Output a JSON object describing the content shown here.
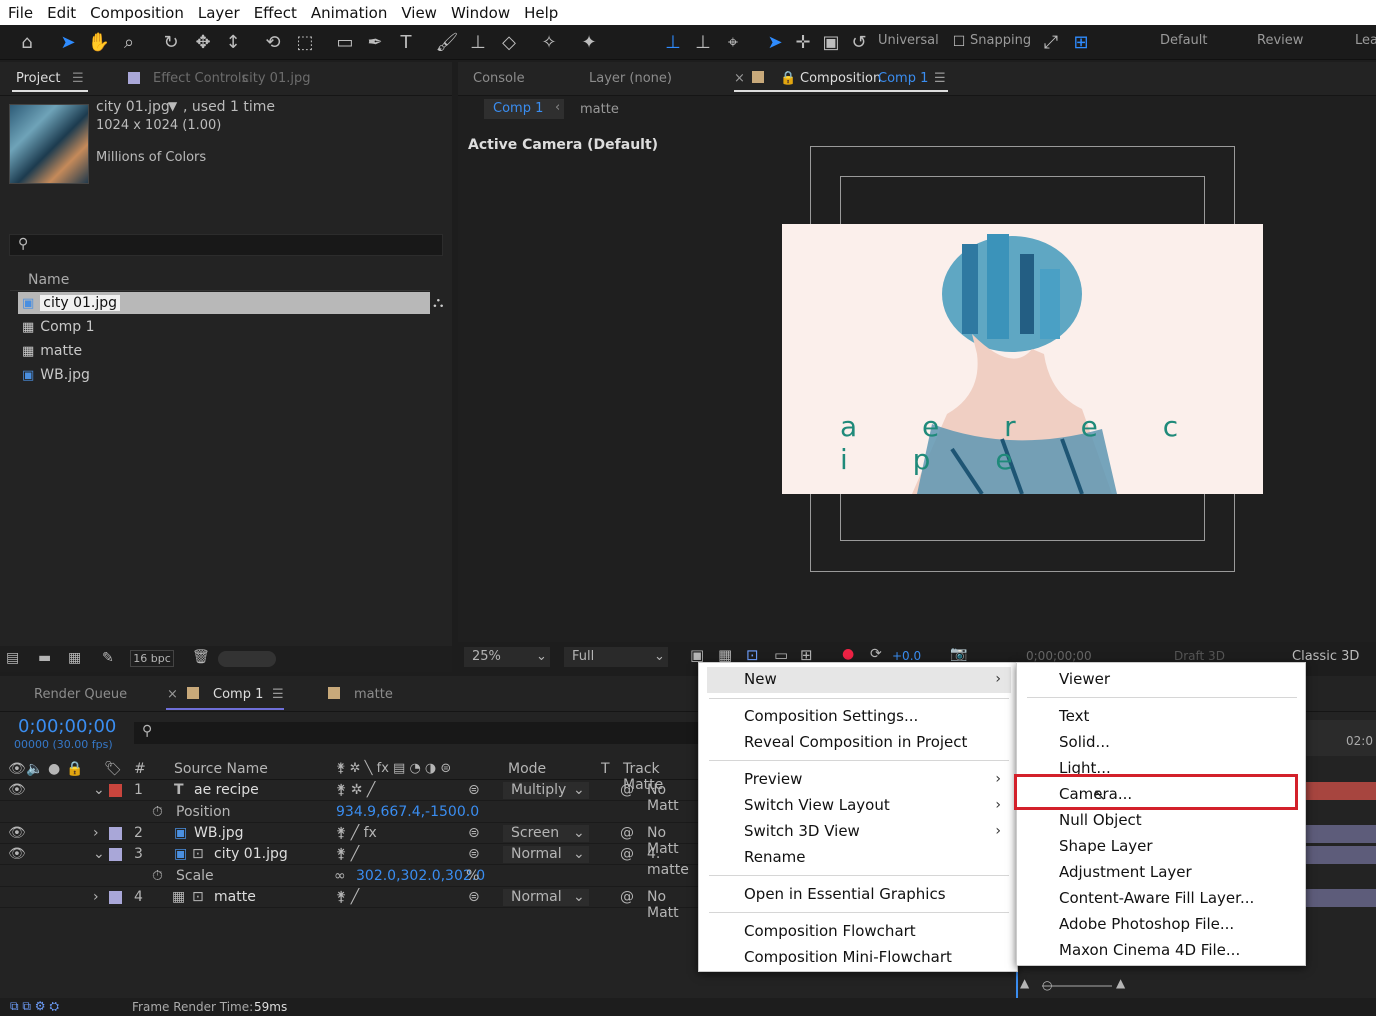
{
  "menubar": [
    "File",
    "Edit",
    "Composition",
    "Layer",
    "Effect",
    "Animation",
    "View",
    "Window",
    "Help"
  ],
  "toolbar": {
    "universal": "Universal",
    "snapping": "Snapping",
    "workspaces": [
      "Default",
      "Review",
      "Lea"
    ]
  },
  "project": {
    "tab": "Project",
    "effect_controls": "Effect Controls",
    "effect_file": "city 01.jpg",
    "file_name": "city 01.jpg",
    "used": ", used 1 time",
    "dims": "1024 x 1024 (1.00)",
    "colors": "Millions of Colors",
    "search_placeholder": "",
    "col_name": "Name",
    "items": [
      "city 01.jpg",
      "Comp 1",
      "matte",
      "WB.jpg"
    ],
    "bpc": "16 bpc"
  },
  "viewer": {
    "tabs": {
      "console": "Console",
      "layer": "Layer (none)",
      "composition": "Composition",
      "comp_name": "Comp 1"
    },
    "breadcrumb": [
      "Comp 1",
      "matte"
    ],
    "camera": "Active Camera (Default)",
    "overlay_text": "a e r e c i p e",
    "zoom": "25%",
    "quality": "Full",
    "offset": "+0.0",
    "timecode": "0;00;00;00",
    "draft": "Draft 3D",
    "renderer": "Classic 3D"
  },
  "timeline": {
    "tabs": {
      "render": "Render Queue",
      "comp": "Comp 1",
      "matte": "matte"
    },
    "time": "0;00;00;00",
    "fps": "00000 (30.00 fps)",
    "headers": {
      "num": "#",
      "source": "Source Name",
      "mode": "Mode",
      "t": "T",
      "track": "Track Matte"
    },
    "ruler": "02:0",
    "layers": [
      {
        "num": "1",
        "name": "ae recipe",
        "mode": "Multiply",
        "matte": "No Matt",
        "color": "#c9453d"
      },
      {
        "prop": "Position",
        "value": "934.9,667.4,-1500.0"
      },
      {
        "num": "2",
        "name": "WB.jpg",
        "mode": "Screen",
        "matte": "No Matt",
        "color": "#a9a7d8"
      },
      {
        "num": "3",
        "name": "city 01.jpg",
        "mode": "Normal",
        "matte": "4. matte",
        "color": "#a9a7d8"
      },
      {
        "prop": "Scale",
        "value": "302.0,302.0,302.0",
        "unit": "%"
      },
      {
        "num": "4",
        "name": "matte",
        "mode": "Normal",
        "matte": "No Matt",
        "color": "#a9a7d8"
      }
    ],
    "status_label": "Frame Render Time:",
    "status_value": "59ms"
  },
  "context_menu": {
    "items": [
      {
        "label": "New",
        "submenu": true
      },
      {
        "label": "Composition Settings..."
      },
      {
        "label": "Reveal Composition in Project"
      },
      {
        "label": "Preview",
        "submenu": true
      },
      {
        "label": "Switch View Layout",
        "submenu": true
      },
      {
        "label": "Switch 3D View",
        "submenu": true
      },
      {
        "label": "Rename"
      },
      {
        "label": "Open in Essential Graphics"
      },
      {
        "label": "Composition Flowchart"
      },
      {
        "label": "Composition Mini-Flowchart"
      }
    ]
  },
  "submenu": {
    "items": [
      "Viewer",
      "Text",
      "Solid...",
      "Light...",
      "Camera...",
      "Null Object",
      "Shape Layer",
      "Adjustment Layer",
      "Content-Aware Fill Layer...",
      "Adobe Photoshop File...",
      "Maxon Cinema 4D File..."
    ],
    "highlight_color": "#d3202a"
  }
}
